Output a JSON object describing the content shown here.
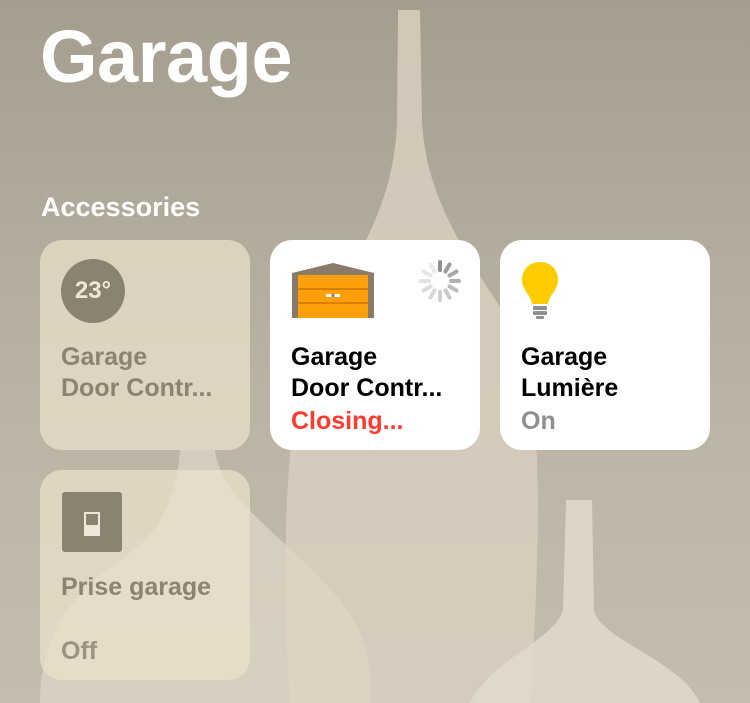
{
  "room": {
    "title": "Garage"
  },
  "section": {
    "title": "Accessories"
  },
  "accessories": [
    {
      "icon": "thermometer-badge-icon",
      "badge": "23°",
      "name": "Garage\nDoor Contr...",
      "status": "",
      "state": "off"
    },
    {
      "icon": "garage-door-icon",
      "name": "Garage\nDoor Contr...",
      "status": "Closing...",
      "state": "on",
      "status_color": "#ff3b30"
    },
    {
      "icon": "lightbulb-icon",
      "name": "Garage\nLumière",
      "status": "On",
      "state": "on",
      "status_color": "#8e8e93"
    },
    {
      "icon": "outlet-switch-icon",
      "name": "Prise garage",
      "status": "Off",
      "state": "off"
    }
  ],
  "colors": {
    "garage_door": "#ff9f0a",
    "bulb": "#ffcc00",
    "closing": "#ff3b30"
  }
}
